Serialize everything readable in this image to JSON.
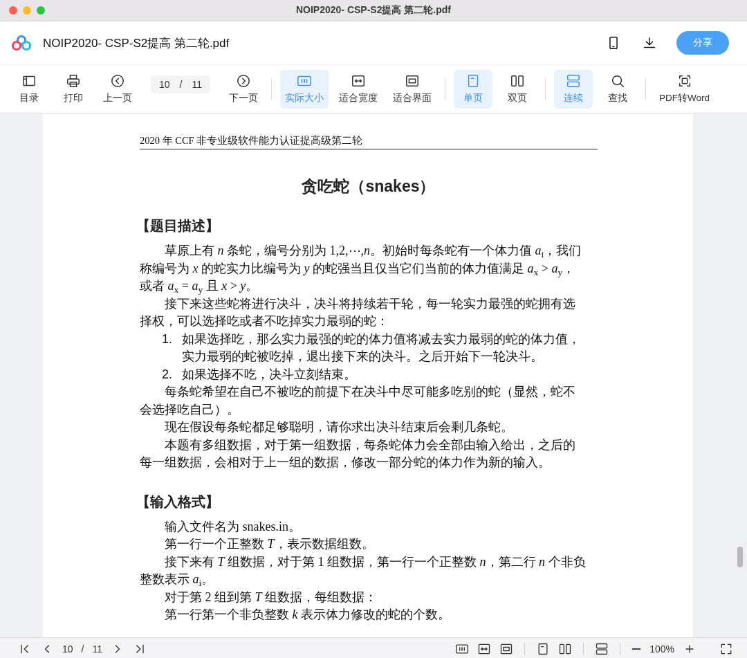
{
  "window": {
    "title": "NOIP2020- CSP-S2提高 第二轮.pdf"
  },
  "header": {
    "file_name": "NOIP2020- CSP-S2提高 第二轮.pdf",
    "share_button": "分享"
  },
  "toolbar": [
    {
      "kind": "sidebar",
      "label": "目录",
      "selected": false,
      "divider_before": false
    },
    {
      "kind": "print",
      "label": "打印",
      "selected": false,
      "divider_before": false
    },
    {
      "kind": "prev",
      "label": "上一页",
      "selected": false,
      "divider_before": false
    },
    {
      "kind": "page",
      "current": "10",
      "separator": "/",
      "total": "11",
      "divider_before": false
    },
    {
      "kind": "next",
      "label": "下一页",
      "selected": false,
      "divider_before": false
    },
    {
      "kind": "actual",
      "label": "实际大小",
      "selected": true,
      "divider_before": true
    },
    {
      "kind": "fitwidth",
      "label": "适合宽度",
      "selected": false,
      "divider_before": false
    },
    {
      "kind": "fitpage",
      "label": "适合界面",
      "selected": false,
      "divider_before": false
    },
    {
      "kind": "single",
      "label": "单页",
      "selected": true,
      "divider_before": true
    },
    {
      "kind": "double",
      "label": "双页",
      "selected": false,
      "divider_before": false
    },
    {
      "kind": "continuous",
      "label": "连续",
      "selected": true,
      "divider_before": true
    },
    {
      "kind": "search",
      "label": "查找",
      "selected": false,
      "divider_before": false
    },
    {
      "kind": "convert",
      "label": "PDF转Word",
      "selected": false,
      "divider_before": true
    }
  ],
  "document": {
    "running_header": "2020 年 CCF 非专业级软件能力认证提高级第二轮",
    "title": "贪吃蛇（snakes）",
    "sections": [
      {
        "heading": "【题目描述】",
        "blocks": [
          {
            "kind": "para",
            "text": "草原上有 *n* 条蛇，编号分别为 1,2,⋯,*n*。初始时每条蛇有一个体力值 *a*$_{i}$，我们称编号为 *x* 的蛇实力比编号为 *y* 的蛇强当且仅当它们当前的体力值满足 *a*$_{x}$ > *a*$_{y}$，或者 *a*$_{x}$ = *a*$_{y}$ 且 *x* > *y*。"
          },
          {
            "kind": "para",
            "text": "接下来这些蛇将进行决斗，决斗将持续若干轮，每一轮实力最强的蛇拥有选择权，可以选择吃或者不吃掉实力最弱的蛇："
          },
          {
            "kind": "item",
            "number": "1.",
            "text": "如果选择吃，那么实力最强的蛇的体力值将减去实力最弱的蛇的体力值，实力最弱的蛇被吃掉，退出接下来的决斗。之后开始下一轮决斗。"
          },
          {
            "kind": "item",
            "number": "2.",
            "text": "如果选择不吃，决斗立刻结束。"
          },
          {
            "kind": "para",
            "text": "每条蛇希望在自己不被吃的前提下在决斗中尽可能多吃别的蛇（显然，蛇不会选择吃自己）。"
          },
          {
            "kind": "para",
            "text": "现在假设每条蛇都足够聪明，请你求出决斗结束后会剩几条蛇。"
          },
          {
            "kind": "para",
            "text": "本题有多组数据，对于第一组数据，每条蛇体力会全部由输入给出，之后的每一组数据，会相对于上一组的数据，修改一部分蛇的体力作为新的输入。"
          }
        ]
      },
      {
        "heading": "【输入格式】",
        "blocks": [
          {
            "kind": "para",
            "text": "输入文件名为 snakes.in。"
          },
          {
            "kind": "para",
            "text": "第一行一个正整数 *T*，表示数据组数。"
          },
          {
            "kind": "para",
            "text": "接下来有 *T* 组数据，对于第 1 组数据，第一行一个正整数 *n*，第二行 *n* 个非负整数表示 *a*$_{i}$。"
          },
          {
            "kind": "para",
            "text": "对于第 2 组到第 *T* 组数据，每组数据："
          },
          {
            "kind": "para",
            "text": "第一行第一个非负整数 *k* 表示体力修改的蛇的个数。"
          }
        ]
      }
    ]
  },
  "status_bar": {
    "page_current": "10",
    "page_separator": "/",
    "page_total": "11",
    "zoom": "100%"
  }
}
